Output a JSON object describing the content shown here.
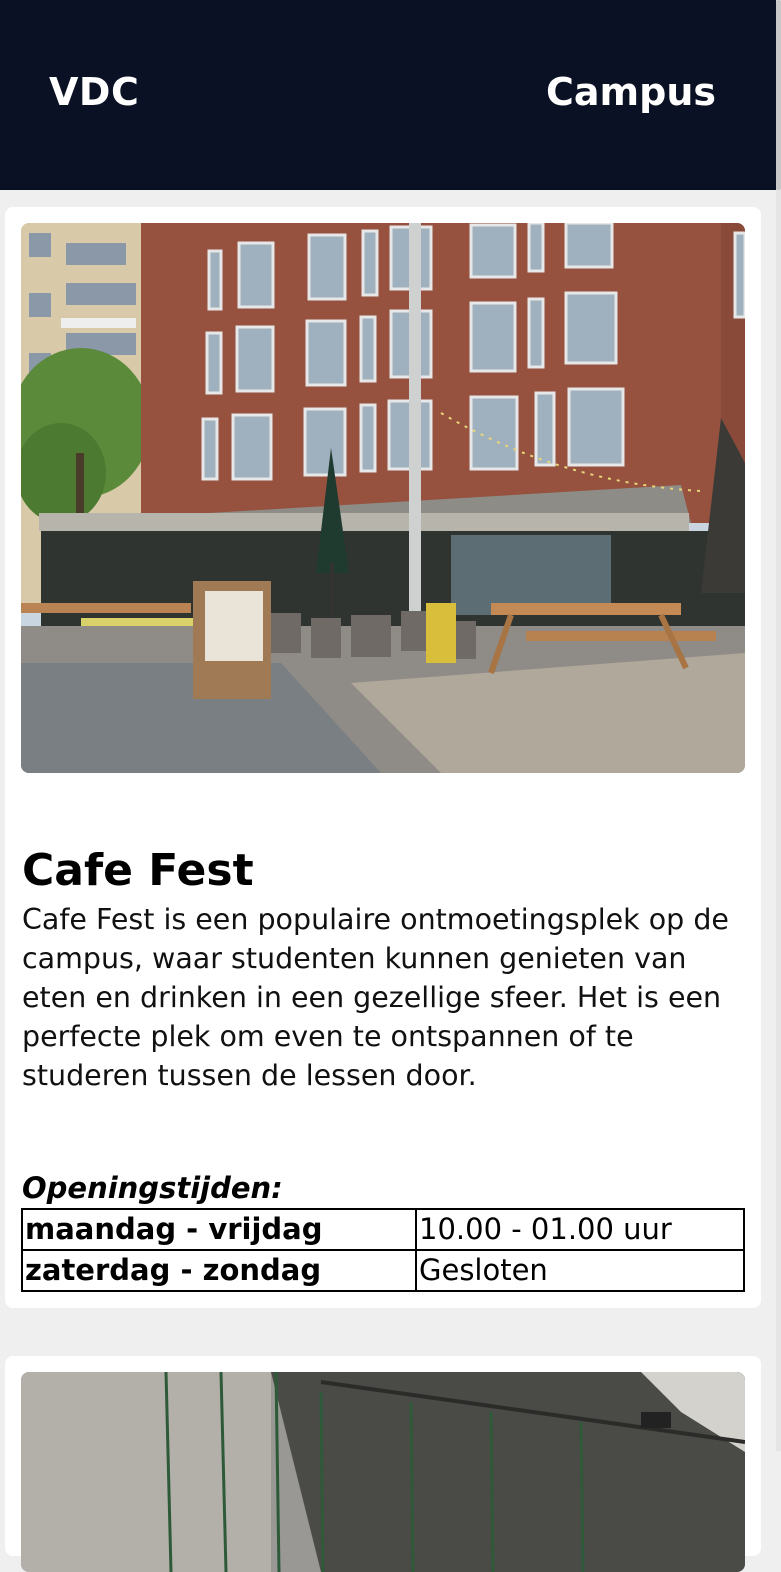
{
  "header": {
    "brand": "VDC",
    "nav_link": "Campus"
  },
  "colors": {
    "header_bg": "#0b1124",
    "page_bg": "#efefef",
    "card_bg": "#ffffff"
  },
  "cards": [
    {
      "image": "cafe-terrace-photo",
      "title": "Cafe Fest",
      "description": "Cafe Fest is een populaire ontmoetingsplek op de campus, waar studenten kunnen genieten van eten en drinken in een gezellige sfeer. Het is een perfecte plek om even te ontspannen of te studeren tussen de lessen door.",
      "hours_heading": "Openingstijden:",
      "hours": [
        {
          "days": "maandag - vrijdag",
          "time": "10.00 - 01.00 uur"
        },
        {
          "days": "zaterdag - zondag",
          "time": "Gesloten"
        }
      ]
    },
    {
      "image": "interior-photo"
    }
  ]
}
